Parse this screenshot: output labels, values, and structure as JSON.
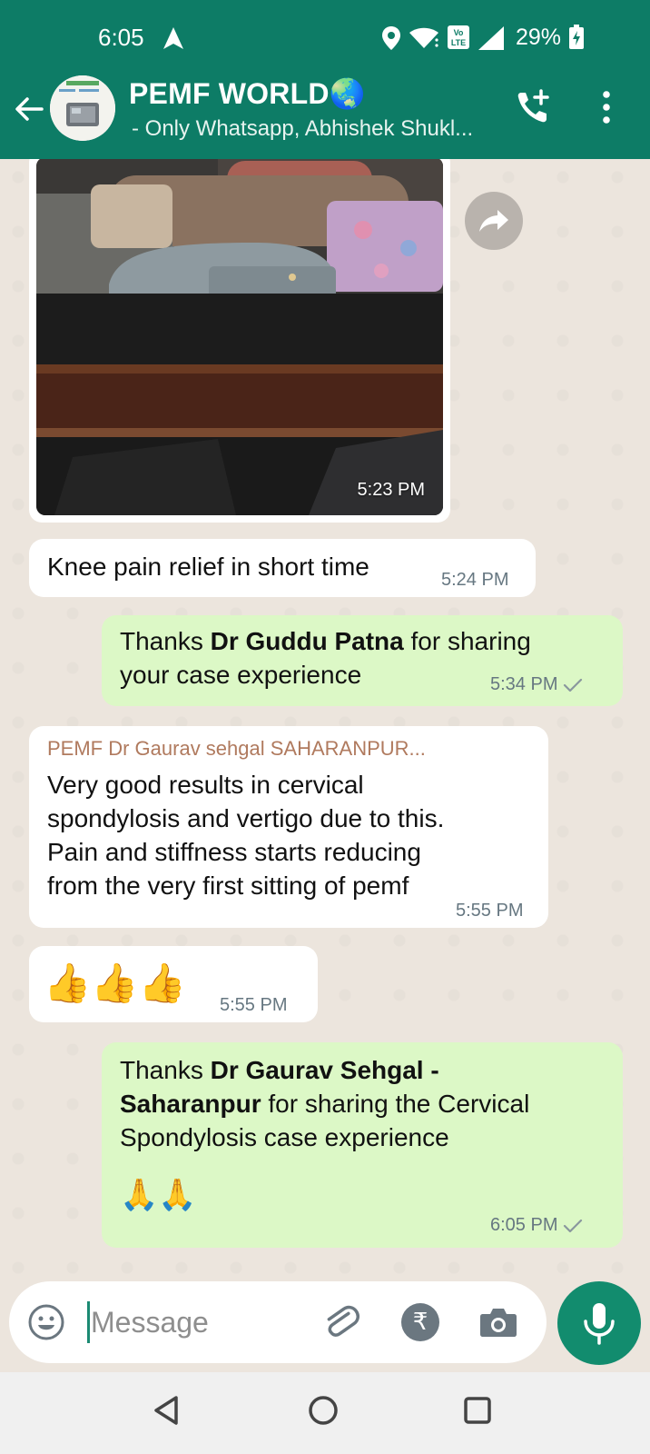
{
  "status_bar": {
    "time": "6:05",
    "battery": "29%"
  },
  "chat_header": {
    "title": "PEMF WORLD🌏",
    "subtitle": "- Only Whatsapp, Abhishek Shukl..."
  },
  "messages": [
    {
      "type": "image",
      "direction": "incoming",
      "time": "5:23 PM"
    },
    {
      "type": "text",
      "direction": "incoming",
      "text": "Knee pain relief in short time",
      "time": "5:24 PM"
    },
    {
      "type": "text",
      "direction": "outgoing",
      "pre": "Thanks ",
      "bold": "Dr Guddu Patna",
      "post_1": " for sharing",
      "post_2": "your case experience",
      "time": "5:34 PM",
      "status": "sent"
    },
    {
      "type": "text",
      "direction": "incoming",
      "sender": "PEMF Dr Gaurav sehgal SAHARANPUR...",
      "lines": [
        "Very good results in cervical",
        "spondylosis and vertigo due to this.",
        "Pain and stiffness starts reducing",
        "from the very first sitting of pemf"
      ],
      "time": "5:55 PM"
    },
    {
      "type": "emoji",
      "direction": "incoming",
      "text": "👍👍👍",
      "time": "5:55 PM"
    },
    {
      "type": "text",
      "direction": "outgoing",
      "pre": "Thanks ",
      "bold_1": "Dr Gaurav Sehgal -",
      "bold_2": "Saharanpur",
      "post_1": " for sharing the Cervical",
      "post_2": "Spondylosis case experience",
      "emoji": "🙏🙏",
      "time": "6:05 PM",
      "status": "sent"
    }
  ],
  "composer": {
    "placeholder": "Message"
  },
  "colors": {
    "header": "#0d7c66",
    "outgoing_bubble": "#dcf8c6",
    "incoming_bubble": "#ffffff",
    "chat_background": "#ece5dd",
    "mic_button": "#128c6e",
    "sender_name": "#b07a5e"
  },
  "icons": [
    "navigation-arrow-icon",
    "location-icon",
    "wifi-icon",
    "volte-icon",
    "signal-icon",
    "battery-icon",
    "back-arrow-icon",
    "add-call-icon",
    "more-options-icon",
    "forward-icon",
    "emoji-icon",
    "attach-icon",
    "rupee-icon",
    "camera-icon",
    "mic-icon",
    "nav-back-icon",
    "nav-home-icon",
    "nav-recents-icon"
  ]
}
